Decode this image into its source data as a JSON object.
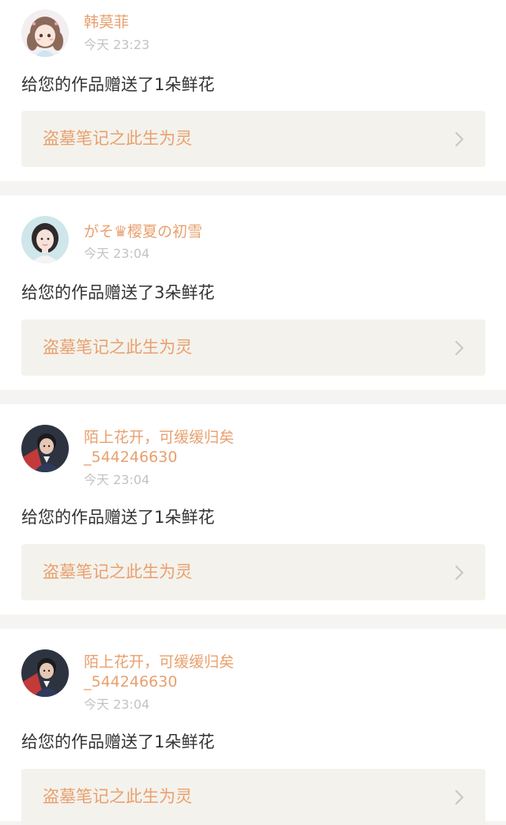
{
  "notifications": [
    {
      "user": "韩莫菲",
      "time": "今天 23:23",
      "message": "给您的作品赠送了1朵鲜花",
      "work_title": "盗墓笔记之此生为灵",
      "avatar_icon": "cartoon-girl-avatar-icon"
    },
    {
      "user": "がそ♛樱夏の初雪",
      "time": "今天 23:04",
      "message": "给您的作品赠送了3朵鲜花",
      "work_title": "盗墓笔记之此生为灵",
      "avatar_icon": "woman-portrait-avatar-icon"
    },
    {
      "user": "陌上花开，可缓缓归矣_544246630",
      "time": "今天 23:04",
      "message": "给您的作品赠送了1朵鲜花",
      "work_title": "盗墓笔记之此生为灵",
      "avatar_icon": "man-portrait-avatar-icon"
    },
    {
      "user": "陌上花开，可缓缓归矣_544246630",
      "time": "今天 23:04",
      "message": "给您的作品赠送了1朵鲜花",
      "work_title": "盗墓笔记之此生为灵",
      "avatar_icon": "man-portrait-avatar-icon"
    }
  ],
  "colors": {
    "accent": "#e8a06e",
    "timestamp": "#c3c3c3",
    "text": "#333333",
    "link_background": "#f4f2ec",
    "separator": "#f5f4f2"
  },
  "icons": {
    "chevron": "chevron-right-icon"
  }
}
